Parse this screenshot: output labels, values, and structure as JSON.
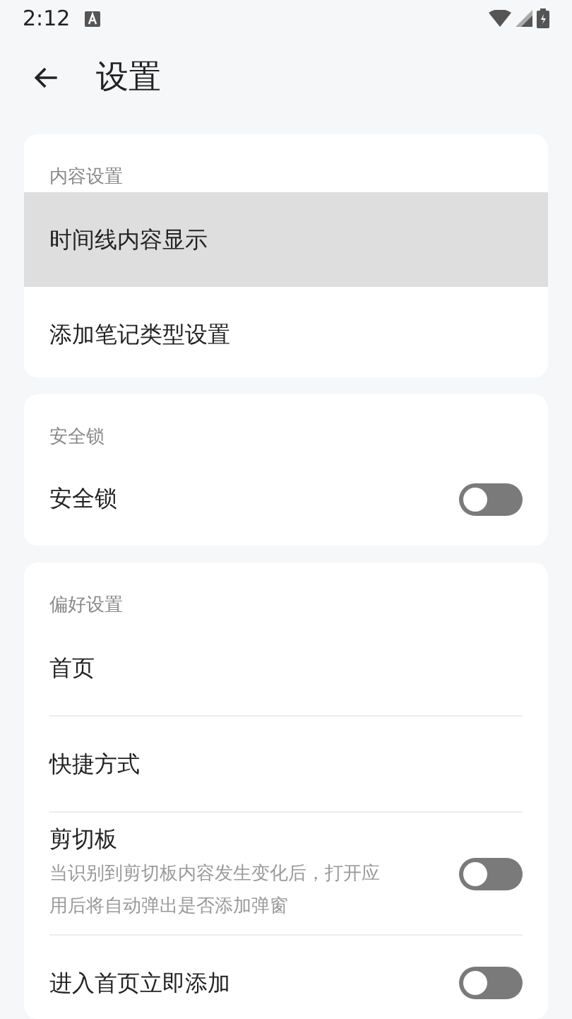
{
  "status_bar": {
    "time": "2:12"
  },
  "header": {
    "title": "设置"
  },
  "sections": [
    {
      "title": "内容设置",
      "dividers": false,
      "items": [
        {
          "kind": "link",
          "label": "时间线内容显示",
          "pressed": true
        },
        {
          "kind": "link",
          "label": "添加笔记类型设置",
          "pressed": false
        }
      ]
    },
    {
      "title": "安全锁",
      "dividers": false,
      "items": [
        {
          "kind": "toggle",
          "label": "安全锁",
          "on": false,
          "pressed": false
        }
      ]
    },
    {
      "title": "偏好设置",
      "dividers": true,
      "items": [
        {
          "kind": "link",
          "label": "首页",
          "pressed": false
        },
        {
          "kind": "link",
          "label": "快捷方式",
          "pressed": false
        },
        {
          "kind": "toggle",
          "label": "剪切板",
          "description": "当识别到剪切板内容发生变化后，打开应用后将自动弹出是否添加弹窗",
          "on": false,
          "pressed": false
        },
        {
          "kind": "toggle",
          "label": "进入首页立即添加",
          "on": false,
          "pressed": false
        }
      ]
    }
  ]
}
